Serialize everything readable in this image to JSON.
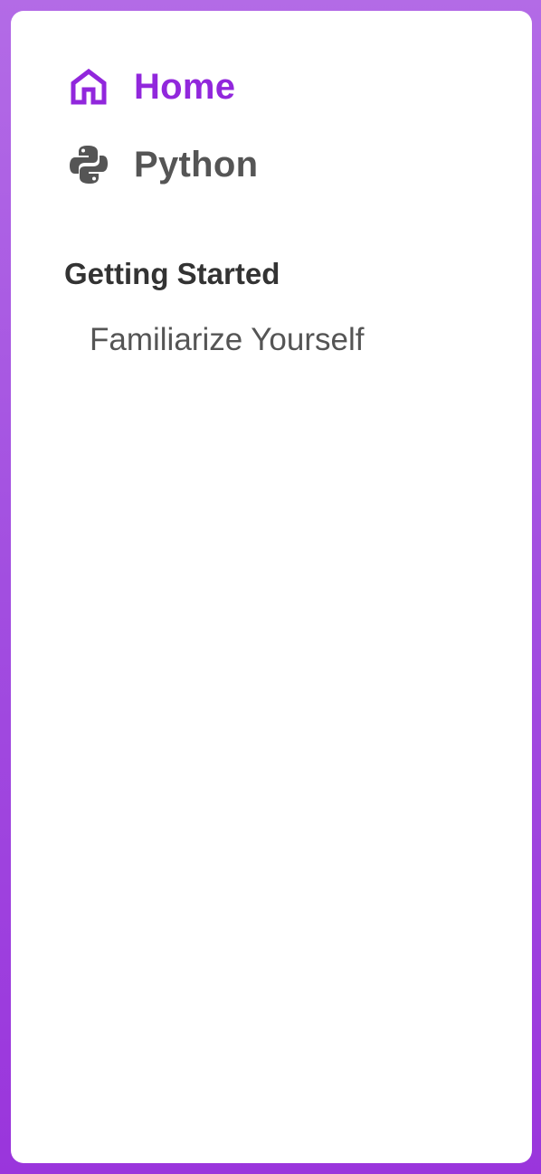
{
  "nav": {
    "items": [
      {
        "label": "Home",
        "icon": "home-icon",
        "active": true
      },
      {
        "label": "Python",
        "icon": "python-icon",
        "active": false
      }
    ]
  },
  "sections": [
    {
      "heading": "Getting Started",
      "links": [
        {
          "label": "Familiarize Yourself"
        }
      ]
    }
  ],
  "colors": {
    "accent": "#9127dc",
    "text": "#555555",
    "heading": "#333333",
    "frame_top": "#b36be6",
    "frame_bottom": "#9a35dc"
  }
}
